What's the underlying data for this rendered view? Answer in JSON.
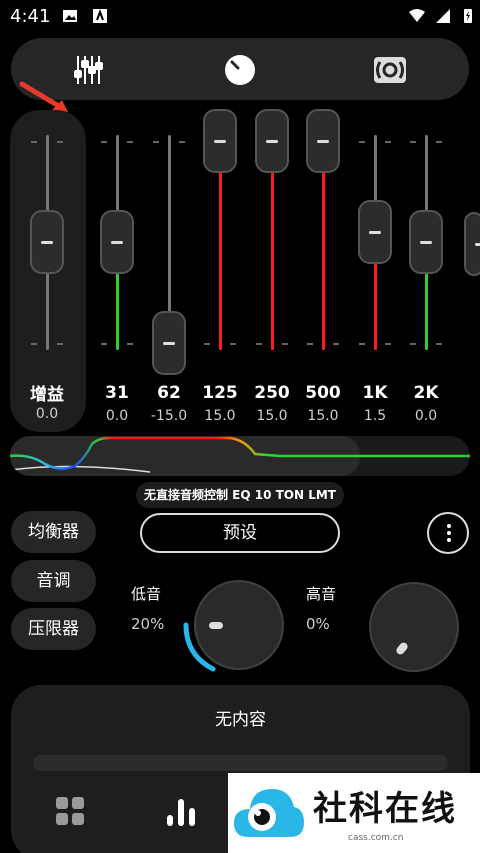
{
  "status_bar": {
    "time": "4:41"
  },
  "tabs": [
    {
      "name": "equalizer",
      "icon": "sliders-icon"
    },
    {
      "name": "bass-knob",
      "icon": "knob-icon"
    },
    {
      "name": "virtualizer",
      "icon": "surround-icon"
    }
  ],
  "gain": {
    "label": "增益",
    "value": "0.0",
    "level": 0.5
  },
  "bands": [
    {
      "label": "31",
      "value": "0.0",
      "gain": 0.0
    },
    {
      "label": "62",
      "value": "-15.0",
      "gain": -15.0
    },
    {
      "label": "125",
      "value": "15.0",
      "gain": 15.0
    },
    {
      "label": "250",
      "value": "15.0",
      "gain": 15.0
    },
    {
      "label": "500",
      "value": "15.0",
      "gain": 15.0
    },
    {
      "label": "1K",
      "value": "1.5",
      "gain": 1.5
    },
    {
      "label": "2K",
      "value": "0.0",
      "gain": 0.0
    }
  ],
  "preset_name": "无直接音频控制 EQ 10 TON LMT",
  "side_buttons": {
    "equalizer": "均衡器",
    "tone": "音调",
    "limiter": "压限器"
  },
  "preset_button": "预设",
  "bass": {
    "label": "低音",
    "value": "20%",
    "level": 0.2
  },
  "treble": {
    "label": "高音",
    "value": "0%",
    "level": 0.0
  },
  "player": {
    "empty_text": "无内容"
  },
  "colors": {
    "boost": "#ff1a1a",
    "cut": "#2fd12f",
    "accent": "#2bb6e8"
  },
  "watermark": {
    "title": "社科在线",
    "url": "cass.com.cn"
  }
}
